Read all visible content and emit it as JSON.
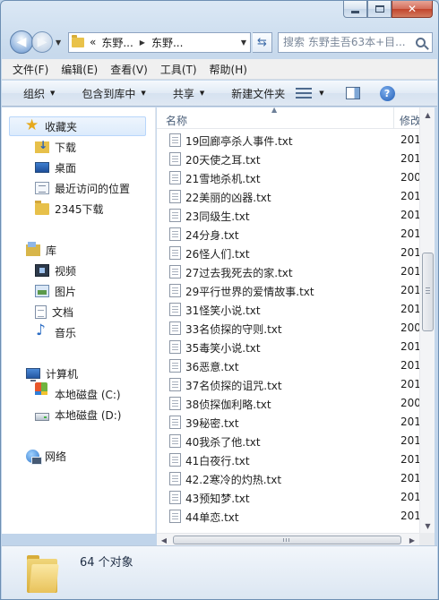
{
  "window": {
    "caption": {
      "minimize": "minimize",
      "maximize": "maximize",
      "close": "close"
    }
  },
  "address": {
    "crumbs": [
      "«",
      "东野...",
      "东野..."
    ],
    "search_placeholder": "搜索 东野圭吾63本+目..."
  },
  "menu": [
    "文件(F)",
    "编辑(E)",
    "查看(V)",
    "工具(T)",
    "帮助(H)"
  ],
  "commands": {
    "organize": "组织",
    "include_library": "包含到库中",
    "share": "共享",
    "new_folder": "新建文件夹"
  },
  "nav": {
    "favorites": "收藏夹",
    "downloads": "下载",
    "desktop": "桌面",
    "recent": "最近访问的位置",
    "d2345": "2345下载",
    "libraries": "库",
    "videos": "视频",
    "pictures": "图片",
    "documents": "文档",
    "music": "音乐",
    "computer": "计算机",
    "disk_c": "本地磁盘 (C:)",
    "disk_d": "本地磁盘 (D:)",
    "network": "网络"
  },
  "columns": {
    "name": "名称",
    "modified": "修改"
  },
  "files": [
    {
      "name": "19回廊亭杀人事件.txt",
      "date": "201"
    },
    {
      "name": "20天使之耳.txt",
      "date": "201"
    },
    {
      "name": "21雪地杀机.txt",
      "date": "200"
    },
    {
      "name": "22美丽的凶器.txt",
      "date": "201"
    },
    {
      "name": "23同级生.txt",
      "date": "201"
    },
    {
      "name": "24分身.txt",
      "date": "201"
    },
    {
      "name": "26怪人们.txt",
      "date": "201"
    },
    {
      "name": "27过去我死去的家.txt",
      "date": "201"
    },
    {
      "name": "29平行世界的爱情故事.txt",
      "date": "201"
    },
    {
      "name": "31怪笑小说.txt",
      "date": "201"
    },
    {
      "name": "33名侦探的守则.txt",
      "date": "200"
    },
    {
      "name": "35毒笑小说.txt",
      "date": "201"
    },
    {
      "name": "36恶意.txt",
      "date": "201"
    },
    {
      "name": "37名侦探的诅咒.txt",
      "date": "201"
    },
    {
      "name": "38侦探伽利略.txt",
      "date": "200"
    },
    {
      "name": "39秘密.txt",
      "date": "201"
    },
    {
      "name": "40我杀了他.txt",
      "date": "201"
    },
    {
      "name": "41白夜行.txt",
      "date": "201"
    },
    {
      "name": "42.2寒冷的灼热.txt",
      "date": "201"
    },
    {
      "name": "43预知梦.txt",
      "date": "201"
    },
    {
      "name": "44单恋.txt",
      "date": "201"
    }
  ],
  "status": {
    "count": "64 个对象"
  }
}
